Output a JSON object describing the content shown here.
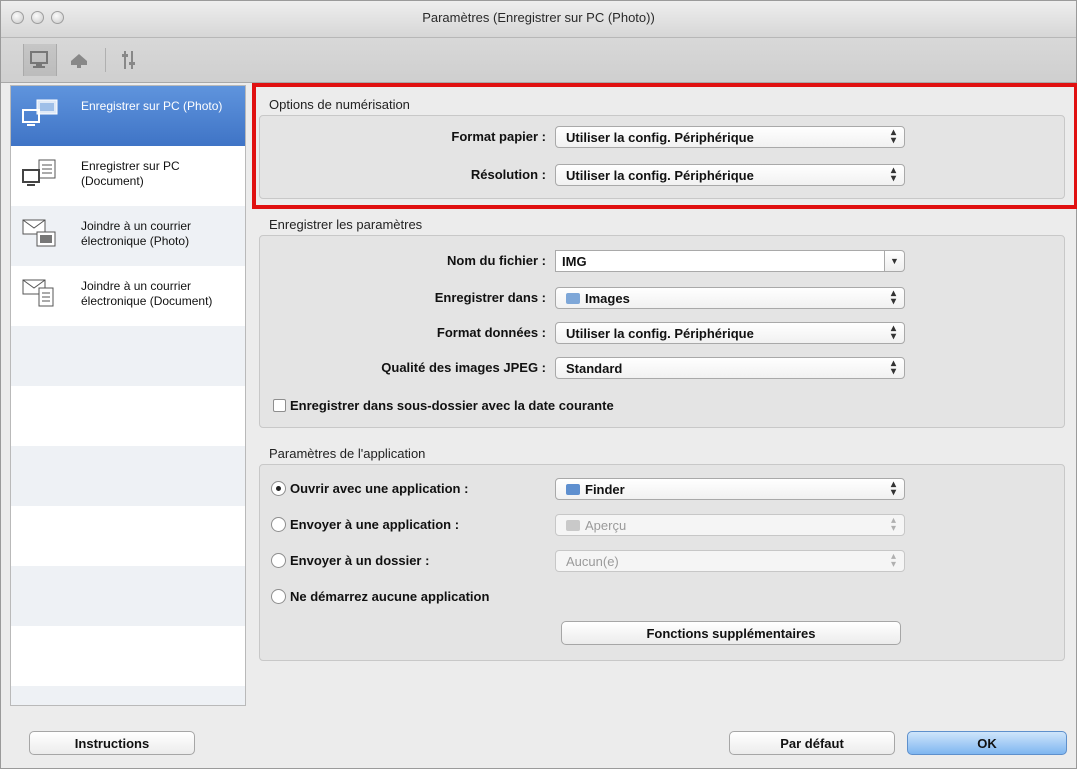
{
  "window": {
    "title": "Paramètres (Enregistrer sur PC (Photo))"
  },
  "toolbar": {
    "icons": [
      "computer-icon",
      "scanner-icon",
      "general-settings-icon"
    ]
  },
  "sidebar": {
    "items": [
      {
        "label": "Enregistrer sur PC (Photo)",
        "selected": true
      },
      {
        "label": "Enregistrer sur PC (Document)",
        "selected": false
      },
      {
        "label": "Joindre à un courrier électronique (Photo)",
        "selected": false
      },
      {
        "label": "Joindre à un courrier électronique (Document)",
        "selected": false
      }
    ]
  },
  "scan_options": {
    "title": "Options de numérisation",
    "paper_size_label": "Format papier :",
    "paper_size_value": "Utiliser la config. Périphérique",
    "resolution_label": "Résolution :",
    "resolution_value": "Utiliser la config. Périphérique"
  },
  "save_settings": {
    "title": "Enregistrer les paramètres",
    "file_name_label": "Nom du fichier :",
    "file_name_value": "IMG",
    "save_in_label": "Enregistrer dans :",
    "save_in_value": "Images",
    "data_format_label": "Format données :",
    "data_format_value": "Utiliser la config. Périphérique",
    "jpeg_quality_label": "Qualité des images JPEG :",
    "jpeg_quality_value": "Standard",
    "subfolder_label": "Enregistrer dans sous-dossier avec la date courante",
    "subfolder_checked": false
  },
  "app_settings": {
    "title": "Paramètres de l'application",
    "open_with_label": "Ouvrir avec une application :",
    "open_with_value": "Finder",
    "send_to_app_label": "Envoyer à une application :",
    "send_to_app_value": "Aperçu",
    "send_to_folder_label": "Envoyer à un dossier :",
    "send_to_folder_value": "Aucun(e)",
    "no_app_label": "Ne démarrez aucune application",
    "selected_option": "open_with",
    "more_functions_label": "Fonctions supplémentaires"
  },
  "footer": {
    "instructions_label": "Instructions",
    "defaults_label": "Par défaut",
    "ok_label": "OK"
  },
  "colors": {
    "highlight": "#e01010",
    "selection": "#3f74c6"
  }
}
